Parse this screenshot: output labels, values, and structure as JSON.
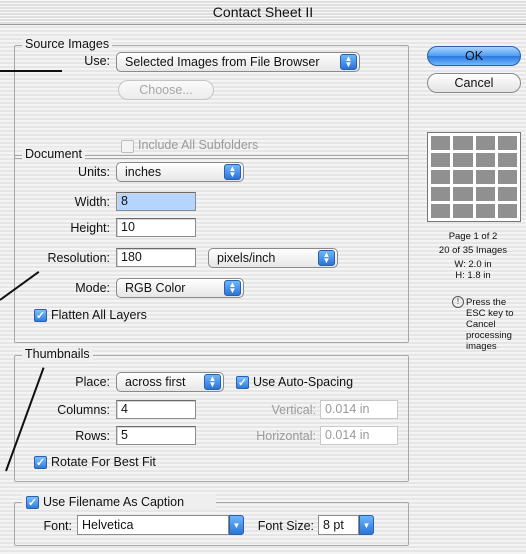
{
  "window": {
    "title": "Contact Sheet II"
  },
  "source_images": {
    "legend": "Source Images",
    "use_label": "Use:",
    "use_value": "Selected Images from File Browser",
    "choose_label": "Choose...",
    "include_subfolders_label": "Include All Subfolders",
    "include_subfolders_checked": false
  },
  "document": {
    "legend": "Document",
    "units_label": "Units:",
    "units_value": "inches",
    "width_label": "Width:",
    "width_value": "8",
    "height_label": "Height:",
    "height_value": "10",
    "resolution_label": "Resolution:",
    "resolution_value": "180",
    "resolution_unit": "pixels/inch",
    "mode_label": "Mode:",
    "mode_value": "RGB Color",
    "flatten_label": "Flatten All Layers",
    "flatten_checked": true
  },
  "thumbnails": {
    "legend": "Thumbnails",
    "place_label": "Place:",
    "place_value": "across first",
    "auto_spacing_label": "Use Auto-Spacing",
    "auto_spacing_checked": true,
    "columns_label": "Columns:",
    "columns_value": "4",
    "rows_label": "Rows:",
    "rows_value": "5",
    "vertical_label": "Vertical:",
    "vertical_value": "0.014 in",
    "horizontal_label": "Horizontal:",
    "horizontal_value": "0.014 in",
    "rotate_label": "Rotate For Best Fit",
    "rotate_checked": true
  },
  "caption": {
    "checkbox_label": "Use Filename As Caption",
    "checked": true,
    "font_label": "Font:",
    "font_value": "Helvetica",
    "font_size_label": "Font Size:",
    "font_size_value": "8 pt"
  },
  "buttons": {
    "ok": "OK",
    "cancel": "Cancel"
  },
  "preview": {
    "page_info": "Page 1 of 2",
    "images_info": "20 of 35 Images",
    "w_info": "W: 2.0 in",
    "h_info": "H: 1.8 in",
    "columns": 4,
    "rows": 5,
    "esc_note_1": "Press the",
    "esc_note_2": "ESC key to",
    "esc_note_3": "Cancel",
    "esc_note_4": "processing",
    "esc_note_5": "images"
  },
  "icons": {
    "info": "info-icon",
    "checkmark": "checkmark-icon",
    "popup_arrows": "popup-arrows-icon"
  },
  "colors": {
    "accent": "#2a73d8",
    "selection": "#b5d5ff"
  }
}
